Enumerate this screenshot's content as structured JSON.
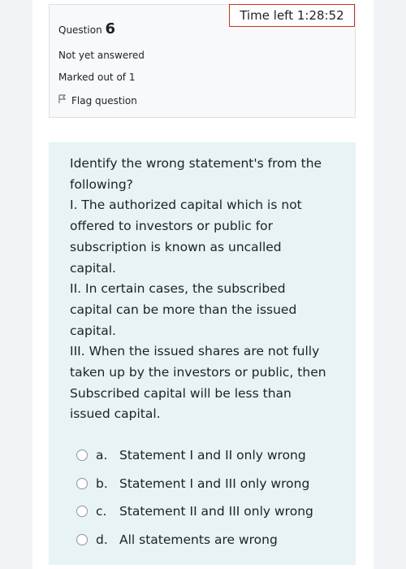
{
  "timer": {
    "label": "Time left 1:28:52"
  },
  "info": {
    "question_label": "Question",
    "question_number": "6",
    "state": "Not yet answered",
    "grade": "Marked out of 1",
    "flag_label": "Flag question"
  },
  "question": {
    "lines": [
      "Identify the wrong statement's from the following?",
      "I. The authorized capital which is not offered to investors or public for subscription is known as uncalled capital.",
      "II. In certain cases, the subscribed capital can be more than the issued capital.",
      "III. When the issued shares are not fully taken up by the investors or public, then Subscribed capital will be less than issued capital."
    ]
  },
  "answers": [
    {
      "letter": "a.",
      "text": "Statement I and II only wrong"
    },
    {
      "letter": "b.",
      "text": "Statement I and III only wrong"
    },
    {
      "letter": "c.",
      "text": "Statement II and III only wrong"
    },
    {
      "letter": "d.",
      "text": "All statements are wrong"
    }
  ]
}
